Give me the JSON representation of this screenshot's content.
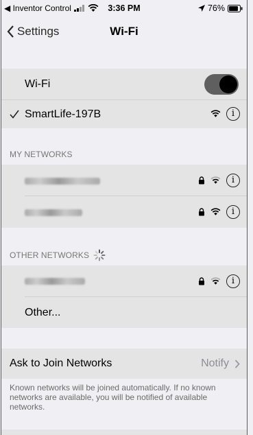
{
  "status_bar": {
    "back_app": "◀ Inventor Control",
    "time": "3:36 PM",
    "battery": "76%"
  },
  "nav": {
    "back_label": "Settings",
    "title": "Wi-Fi"
  },
  "wifi": {
    "toggle_label": "Wi-Fi",
    "toggle_on": true,
    "connected_network": "SmartLife-197B"
  },
  "my_networks": {
    "header": "MY NETWORKS"
  },
  "other_networks": {
    "header": "OTHER NETWORKS",
    "other_label": "Other..."
  },
  "ask_to_join": {
    "label": "Ask to Join Networks",
    "value": "Notify",
    "footer": "Known networks will be joined automatically. If no known networks are available, you will be notified of available networks."
  },
  "icons": {
    "checkmark": "checkmark-icon",
    "lock": "lock-icon",
    "wifi": "wifi-signal-icon",
    "info": "info-icon",
    "spinner": "loading-spinner-icon",
    "chevron": "chevron-right-icon"
  }
}
